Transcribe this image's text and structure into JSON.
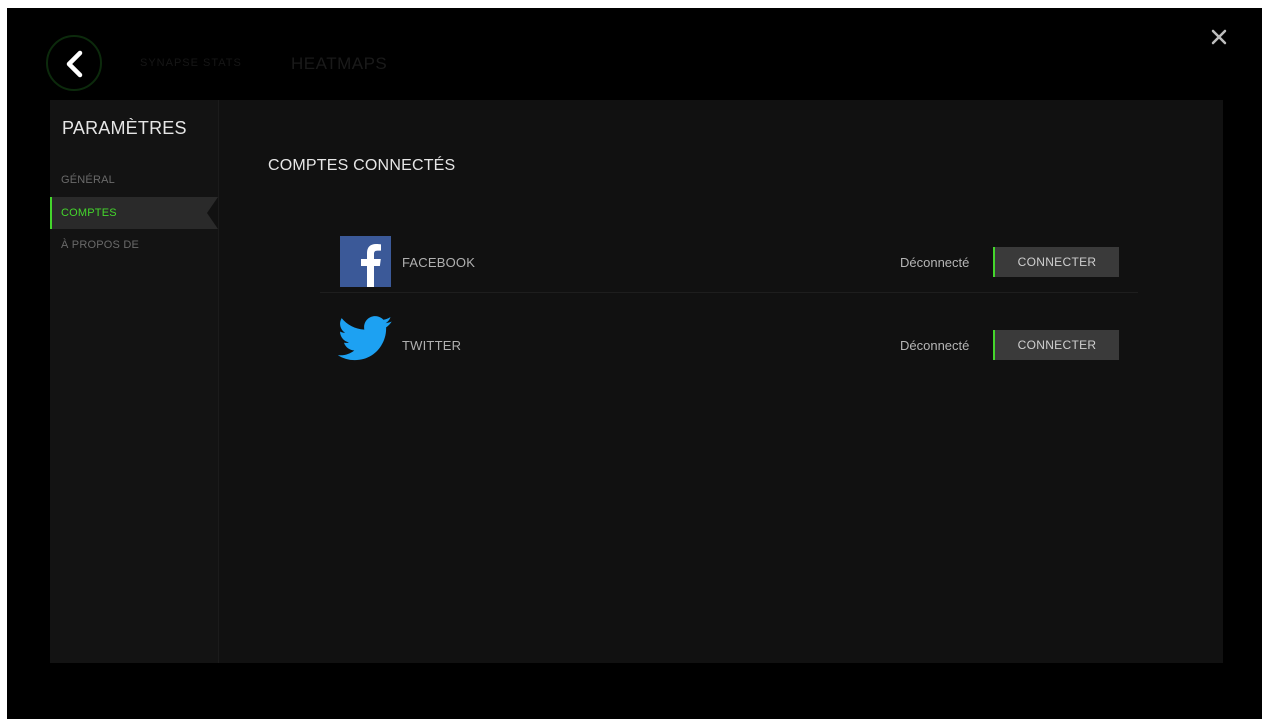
{
  "header": {
    "back_icon": "chevron-left-icon",
    "breadcrumb_dim": "SYNAPSE STATS",
    "title_dim": "HEATMAPS",
    "close_icon": "close-icon"
  },
  "sidebar": {
    "title": "PARAMÈTRES",
    "items": [
      {
        "label": "GÉNÉRAL",
        "active": false
      },
      {
        "label": "COMPTES",
        "active": true
      },
      {
        "label": "À PROPOS DE",
        "active": false
      }
    ]
  },
  "main": {
    "section_title": "COMPTES CONNECTÉS",
    "accounts": [
      {
        "name": "FACEBOOK",
        "icon": "facebook-icon",
        "status": "Déconnecté",
        "button_label": "CONNECTER"
      },
      {
        "name": "TWITTER",
        "icon": "twitter-icon",
        "status": "Déconnecté",
        "button_label": "CONNECTER"
      }
    ]
  },
  "colors": {
    "accent": "#44d62c",
    "background": "#000000",
    "panel": "#111111",
    "facebook_blue": "#3b5998",
    "twitter_blue": "#1da1f2"
  }
}
